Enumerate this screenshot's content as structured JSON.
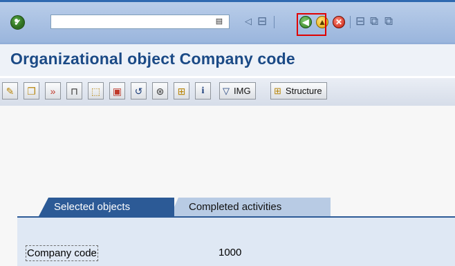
{
  "system_toolbar": {
    "enter_icon": "green-check-icon",
    "command_field_value": "",
    "command_dropdown_icon": "command-history-icon",
    "save_icon": "save-icon",
    "back_icon": "back-arrow-icon",
    "exit_icon": "exit-icon",
    "cancel_icon": "cancel-icon",
    "print_icon": "print-icon",
    "find_icon": "find-icon",
    "find_next_icon": "find-next-icon",
    "highlight_color": "#e00000"
  },
  "header": {
    "title": "Organizational object Company code",
    "title_color": "#1b4a86"
  },
  "app_toolbar": {
    "buttons": [
      {
        "icon": "pencil-icon"
      },
      {
        "icon": "copy-icon"
      },
      {
        "icon": "copy-as-icon"
      },
      {
        "icon": "delete-icon"
      },
      {
        "icon": "check-icon"
      },
      {
        "icon": "transport-icon"
      },
      {
        "icon": "undo-icon"
      },
      {
        "icon": "settings-icon"
      },
      {
        "icon": "hierarchy-icon"
      },
      {
        "icon": "info-icon"
      }
    ],
    "img_button": {
      "icon": "filter-icon",
      "label": "IMG"
    },
    "structure_button": {
      "icon": "structure-icon",
      "label": "Structure"
    }
  },
  "tabs": [
    {
      "label": "Selected objects",
      "active": true
    },
    {
      "label": "Completed activities",
      "active": false
    }
  ],
  "fields": {
    "company_code": {
      "label": "Company code",
      "value": "1000"
    }
  },
  "colors": {
    "active_tab": "#2c5a96",
    "inactive_tab": "#b8cbe4",
    "panel": "#dfe8f4"
  }
}
